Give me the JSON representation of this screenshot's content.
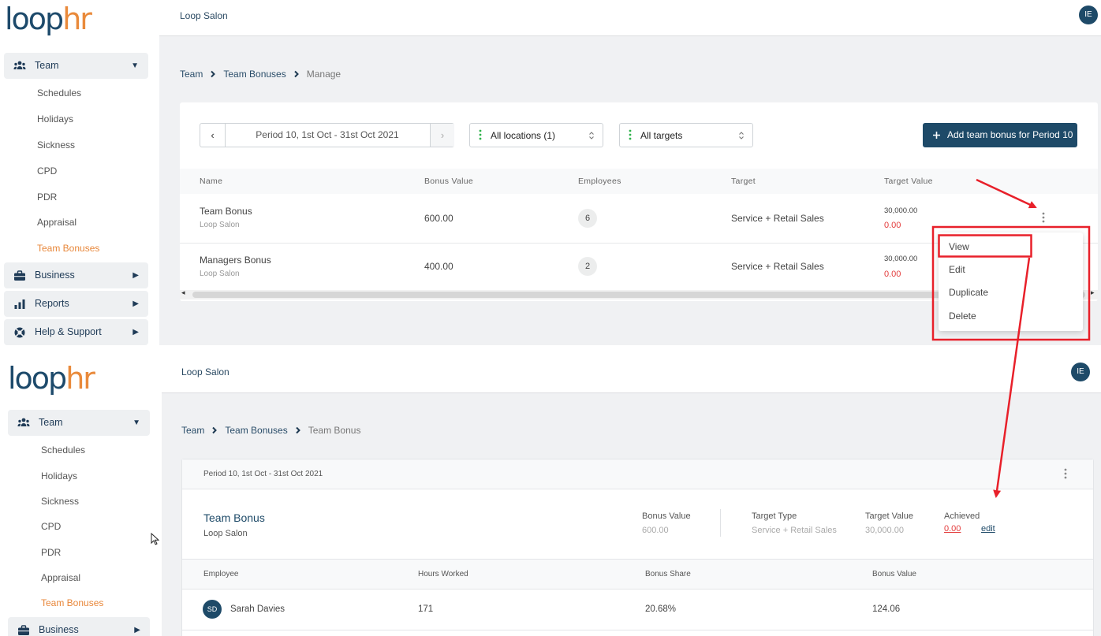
{
  "colors": {
    "navy": "#1e4a68",
    "accent_orange": "#e8873a",
    "negative_red": "#e33b3b",
    "annotation_red": "#e8202a",
    "location_dots_green": "#2db24a"
  },
  "brand": {
    "logo_primary": "loop",
    "logo_accent": "hr"
  },
  "sidebar": {
    "groups": [
      {
        "label": "Team",
        "icon": "team-icon",
        "expanded": true
      },
      {
        "label": "Business",
        "icon": "briefcase-icon"
      },
      {
        "label": "Reports",
        "icon": "bar-chart-icon"
      },
      {
        "label": "Help & Support",
        "icon": "lifebuoy-icon"
      }
    ],
    "team_items": [
      "Schedules",
      "Holidays",
      "Sickness",
      "CPD",
      "PDR",
      "Appraisal",
      "Team Bonuses"
    ],
    "active_item": "Team Bonuses"
  },
  "header": {
    "company": "Loop Salon",
    "avatar_initials": "IE"
  },
  "manage_screen": {
    "breadcrumb": [
      "Team",
      "Team Bonuses",
      "Manage"
    ],
    "toolbar": {
      "period": "Period 10, 1st Oct - 31st Oct 2021",
      "locations": "All locations (1)",
      "targets": "All targets",
      "add_button": "Add team bonus for Period 10"
    },
    "columns": [
      "Name",
      "Bonus Value",
      "Employees",
      "Target",
      "Target Value"
    ],
    "rows": [
      {
        "name": "Team Bonus",
        "location": "Loop Salon",
        "bonus_value": "600.00",
        "employees": "6",
        "target": "Service + Retail Sales",
        "target_value": "30,000.00",
        "achieved": "0.00"
      },
      {
        "name": "Managers Bonus",
        "location": "Loop Salon",
        "bonus_value": "400.00",
        "employees": "2",
        "target": "Service + Retail Sales",
        "target_value": "30,000.00",
        "achieved": "0.00"
      }
    ],
    "row_menu": [
      "View",
      "Edit",
      "Duplicate",
      "Delete"
    ]
  },
  "detail_screen": {
    "breadcrumb": [
      "Team",
      "Team Bonuses",
      "Team Bonus"
    ],
    "period": "Period 10, 1st Oct - 31st Oct 2021",
    "bonus": {
      "name": "Team Bonus",
      "location": "Loop Salon",
      "bonus_value_label": "Bonus Value",
      "bonus_value": "600.00",
      "target_type_label": "Target Type",
      "target_type": "Service + Retail Sales",
      "target_value_label": "Target Value",
      "target_value": "30,000.00",
      "achieved_label": "Achieved",
      "achieved": "0.00",
      "edit_link": "edit"
    },
    "columns": [
      "Employee",
      "Hours Worked",
      "Bonus Share",
      "Bonus Value"
    ],
    "rows": [
      {
        "initials": "SD",
        "employee": "Sarah Davies",
        "hours_worked": "171",
        "bonus_share": "20.68%",
        "bonus_value": "124.06"
      }
    ]
  }
}
